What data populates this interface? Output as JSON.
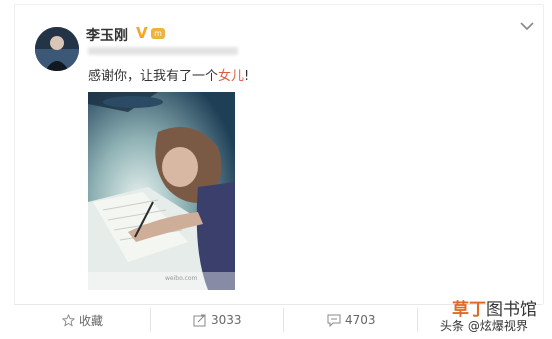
{
  "post": {
    "username": "李玉刚",
    "verified_mark": "V",
    "level_badge": "m",
    "text_before": "感谢你，让我有了一个",
    "text_highlight": "女儿",
    "text_after": "!",
    "photo_watermark": "weibo.com"
  },
  "actions": {
    "favorite_label": "收藏",
    "repost_count": "3033",
    "comment_count": "4703"
  },
  "watermark": {
    "brand_colored": "草丁",
    "brand_rest": "图书馆",
    "source_text": "头条 @炫爆视界"
  },
  "colors": {
    "highlight": "#e05a3e",
    "verified": "#f5a623",
    "brand": "#e06a25"
  },
  "icons": [
    "chevron-down-icon",
    "star-icon",
    "repost-icon",
    "comment-icon"
  ]
}
